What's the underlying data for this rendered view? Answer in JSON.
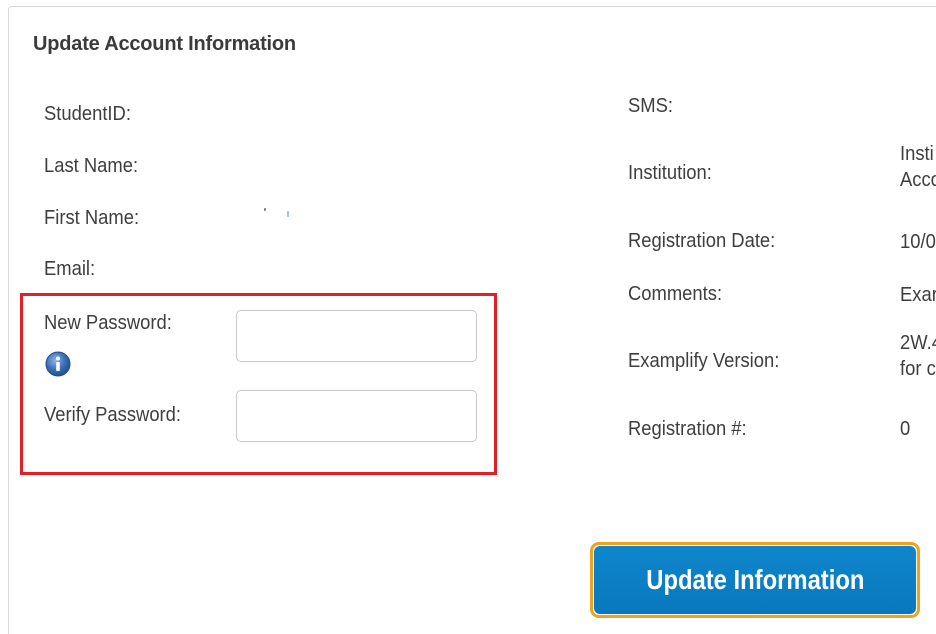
{
  "panel": {
    "title": "Update Account Information"
  },
  "left_fields": {
    "student_id_label": "StudentID:",
    "last_name_label": "Last Name:",
    "first_name_label": "First Name:",
    "email_label": "Email:",
    "new_password_label": "New Password:",
    "verify_password_label": "Verify Password:",
    "new_password_value": "",
    "verify_password_value": ""
  },
  "right_fields": {
    "sms_label": "SMS:",
    "institution_label": "Institution:",
    "institution_value_line1": "Insti",
    "institution_value_line2": "Acco",
    "registration_date_label": "Registration Date:",
    "registration_date_value": "10/0",
    "comments_label": "Comments:",
    "comments_value": "Exar",
    "examplify_version_label": "Examplify Version:",
    "examplify_version_line1": "2W.4",
    "examplify_version_line2": "for c",
    "registration_number_label": "Registration #:",
    "registration_number_value": "0"
  },
  "actions": {
    "update_button_label": "Update Information"
  },
  "colors": {
    "highlight_border": "#e01f26",
    "button_bg": "#0a7ec4",
    "button_focus_ring": "#f0a21e",
    "info_icon": "#3a6fb5"
  },
  "icons": {
    "info": "info-icon"
  }
}
